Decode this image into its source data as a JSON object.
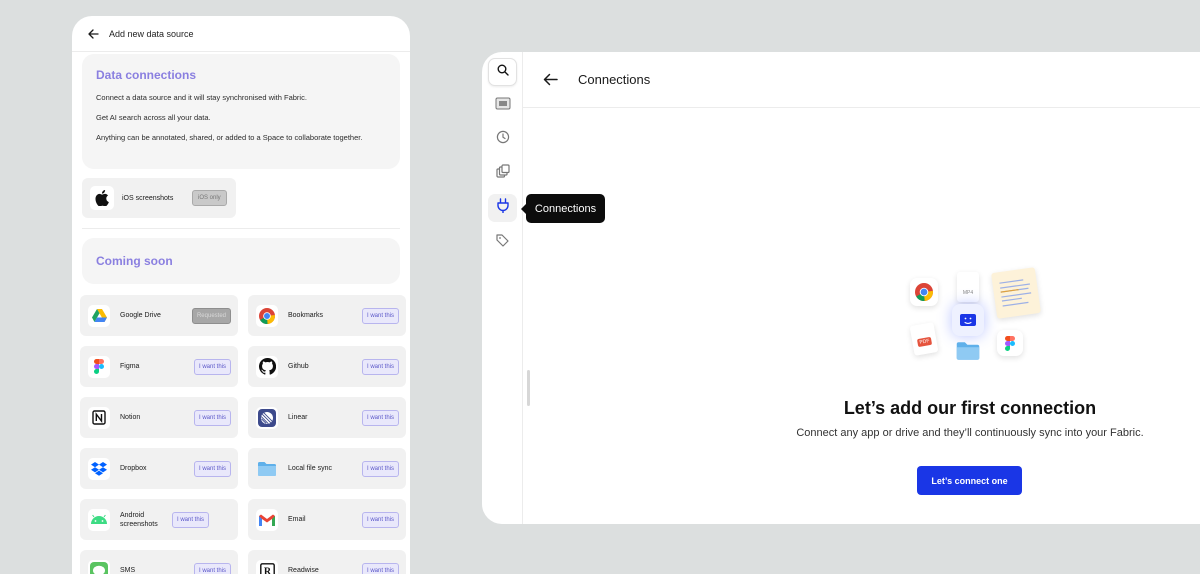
{
  "add_source": {
    "header_title": "Add new data source",
    "data_connections": {
      "title": "Data connections",
      "paragraphs": [
        "Connect a data source and it will stay synchronised with Fabric.",
        "Get AI search across all your data.",
        "Anything can be annotated, shared, or added to a Space to collaborate together."
      ]
    },
    "ios": {
      "label": "iOS screenshots",
      "badge": "iOS only",
      "icon": "apple-icon"
    },
    "coming_soon_title": "Coming soon",
    "sources": [
      {
        "name": "Google Drive",
        "action": "Requested",
        "icon": "google-drive-icon"
      },
      {
        "name": "Bookmarks",
        "action": "I want this",
        "icon": "chrome-icon"
      },
      {
        "name": "Figma",
        "action": "I want this",
        "icon": "figma-icon"
      },
      {
        "name": "Github",
        "action": "I want this",
        "icon": "github-icon"
      },
      {
        "name": "Notion",
        "action": "I want this",
        "icon": "notion-icon"
      },
      {
        "name": "Linear",
        "action": "I want this",
        "icon": "linear-icon"
      },
      {
        "name": "Dropbox",
        "action": "I want this",
        "icon": "dropbox-icon"
      },
      {
        "name": "Local file sync",
        "action": "I want this",
        "icon": "folder-icon"
      },
      {
        "name": "Android screenshots",
        "action": "I want this",
        "icon": "android-icon"
      },
      {
        "name": "Email",
        "action": "I want this",
        "icon": "gmail-icon"
      },
      {
        "name": "SMS",
        "action": "I want this",
        "icon": "messages-icon"
      },
      {
        "name": "Readwise",
        "action": "I want this",
        "icon": "readwise-icon"
      }
    ]
  },
  "connections": {
    "header_title": "Connections",
    "tooltip": "Connections",
    "empty_title": "Let’s add our first connection",
    "empty_subtitle": "Connect any app or drive and they’ll continuously sync into your Fabric.",
    "cta_label": "Let’s connect one",
    "illustration": {
      "mp4_label": "MP4",
      "pdf_label": "PDF"
    },
    "rail_icons": [
      "search-icon",
      "screen-folder-icon",
      "history-icon",
      "copies-icon",
      "plug-icon",
      "tag-icon"
    ]
  },
  "colors": {
    "accent_purple": "#8a7fe0",
    "primary_blue": "#1a36e6",
    "background": "#dcdfdf"
  }
}
